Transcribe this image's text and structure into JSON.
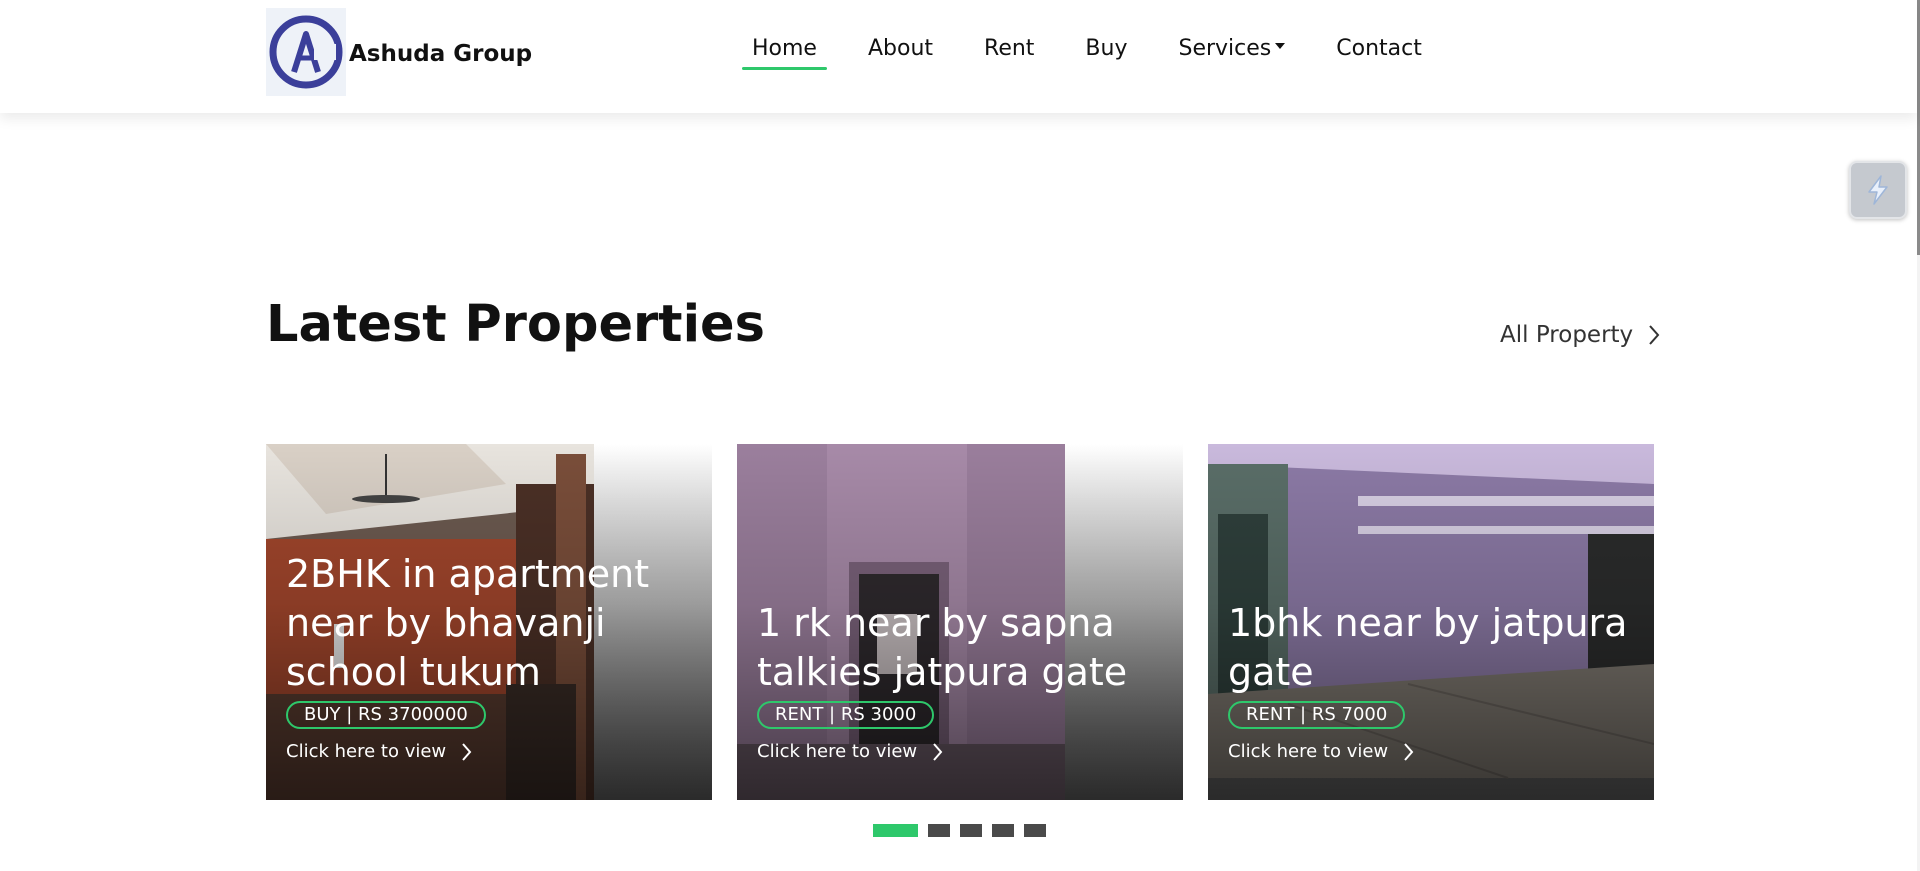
{
  "brand": {
    "name": "Ashuda Group",
    "logo_letter": "AG"
  },
  "nav": {
    "items": [
      {
        "label": "Home",
        "active": true
      },
      {
        "label": "About",
        "active": false
      },
      {
        "label": "Rent",
        "active": false
      },
      {
        "label": "Buy",
        "active": false
      },
      {
        "label": "Services",
        "active": false,
        "dropdown": true
      },
      {
        "label": "Contact",
        "active": false
      }
    ]
  },
  "section": {
    "title": "Latest Properties",
    "all_link": "All Property"
  },
  "cards": [
    {
      "title": "2BHK in apartment near by bhavanji school tukum",
      "badge": "BUY | RS 3700000",
      "link": "Click here to view"
    },
    {
      "title": "1 rk near by sapna talkies jatpura gate",
      "badge": "RENT | RS 3000",
      "link": "Click here to view"
    },
    {
      "title": "1bhk near by jatpura gate",
      "badge": "RENT | RS 7000",
      "link": "Click here to view"
    }
  ],
  "pagination": {
    "count": 5,
    "active_index": 0
  },
  "colors": {
    "accent": "#2ec86b",
    "dot_inactive": "#4a4a4a",
    "text": "#111111"
  },
  "icons": {
    "chevron": "chevron-right-icon",
    "caret": "caret-down-icon",
    "widget": "bolt-widget-icon"
  }
}
